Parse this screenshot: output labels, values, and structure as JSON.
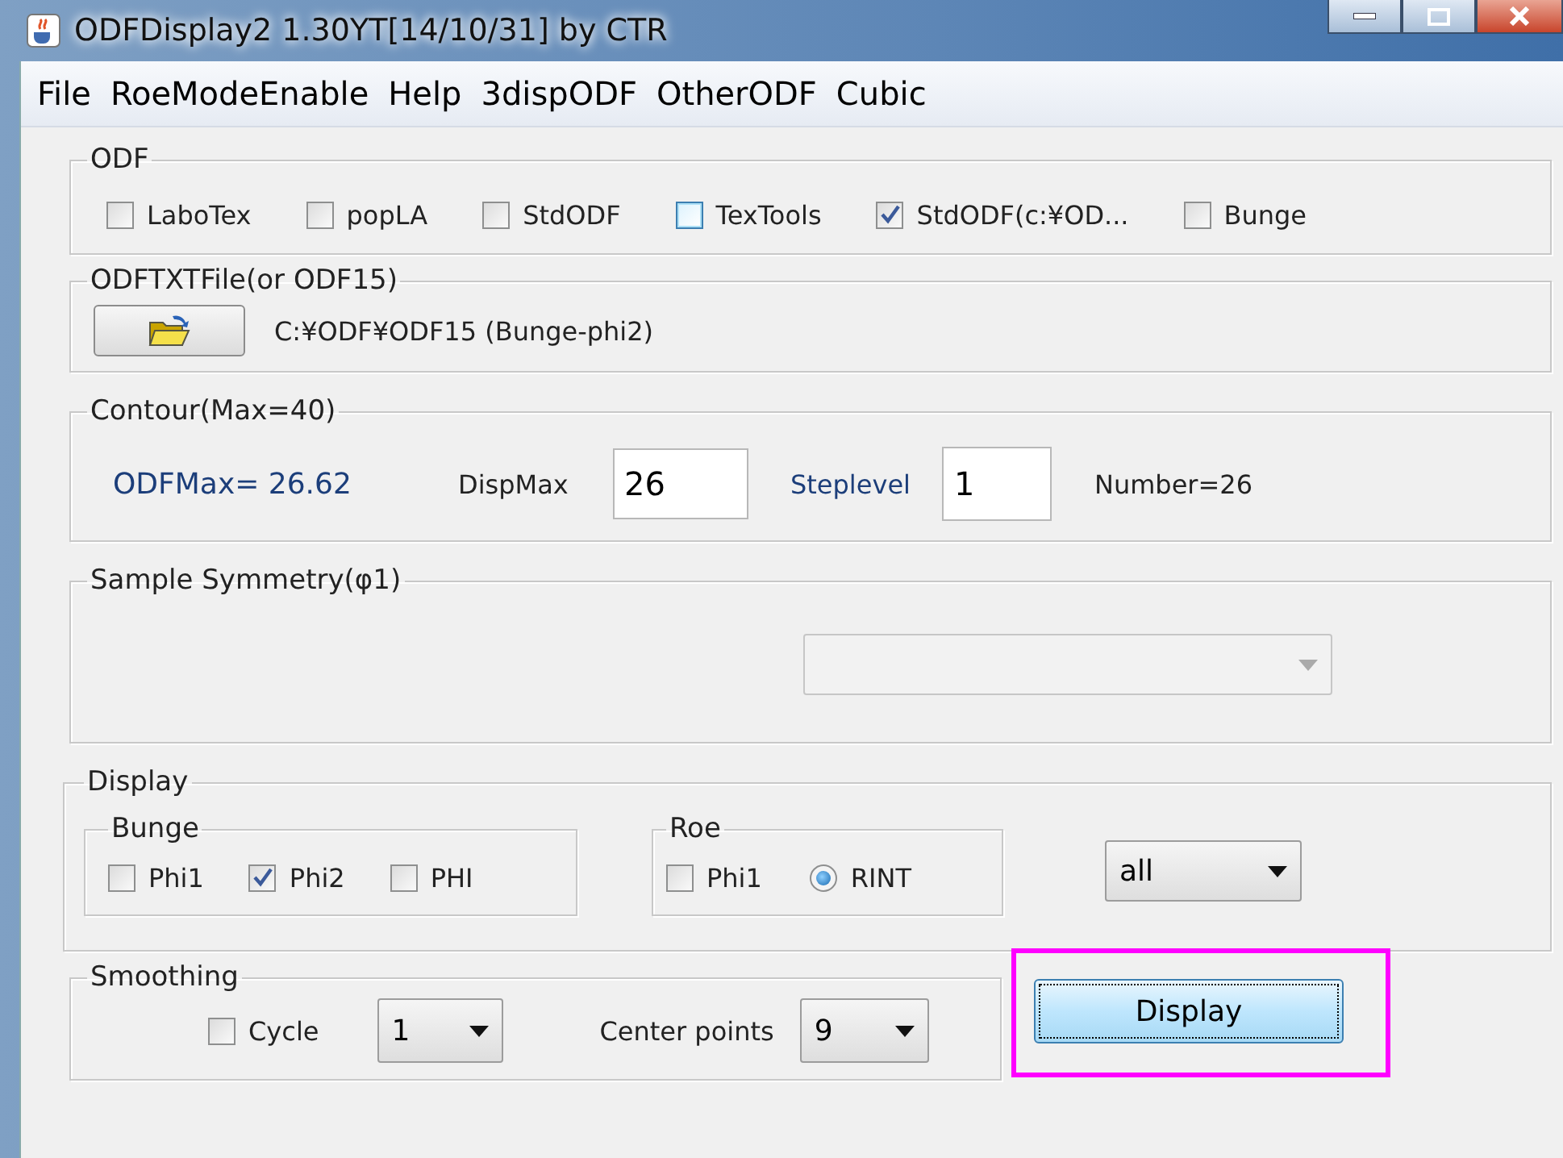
{
  "window": {
    "title": "ODFDisplay2 1.30YT[14/10/31] by CTR"
  },
  "menu": [
    "File",
    "RoeModeEnable",
    "Help",
    "3dispODF",
    "OtherODF",
    "Cubic"
  ],
  "odf": {
    "legend": "ODF",
    "options": [
      {
        "label": "LaboTex",
        "checked": false,
        "hovered": false
      },
      {
        "label": "popLA",
        "checked": false,
        "hovered": false
      },
      {
        "label": "StdODF",
        "checked": false,
        "hovered": false
      },
      {
        "label": "TexTools",
        "checked": false,
        "hovered": true
      },
      {
        "label": "StdODF(c:¥OD...",
        "checked": true,
        "hovered": false
      },
      {
        "label": "Bunge",
        "checked": false,
        "hovered": false
      }
    ]
  },
  "odf_file": {
    "legend": "ODFTXTFile(or ODF15)",
    "path": "C:¥ODF¥ODF15 (Bunge-phi2)"
  },
  "contour": {
    "legend": "Contour(Max=40)",
    "odf_max": "ODFMax= 26.62",
    "disp_max_label": "DispMax",
    "disp_max_value": "26",
    "step_label": "Steplevel",
    "step_value": "1",
    "number": "Number=26"
  },
  "sample_symmetry": {
    "legend": "Sample Symmetry(φ1)",
    "dropdown": {
      "disabled": true
    }
  },
  "display": {
    "legend": "Display",
    "bunge": {
      "legend": "Bunge",
      "options": [
        {
          "kind": "checkbox",
          "label": "Phi1",
          "checked": false
        },
        {
          "kind": "checkbox",
          "label": "Phi2",
          "checked": true
        },
        {
          "kind": "checkbox",
          "label": "PHI",
          "checked": false
        }
      ]
    },
    "roe": {
      "legend": "Roe",
      "options": [
        {
          "kind": "checkbox",
          "label": "Phi1",
          "checked": false
        },
        {
          "kind": "radio",
          "label": "RINT",
          "checked": true
        }
      ]
    },
    "view": {
      "value": "all"
    }
  },
  "smoothing": {
    "legend": "Smoothing",
    "cycle": {
      "label": "Cycle",
      "checked": false
    },
    "cycle_value": "1",
    "center_label": "Center points",
    "center_value": "9"
  },
  "display_button": {
    "label": "Display",
    "highlighted": true
  }
}
